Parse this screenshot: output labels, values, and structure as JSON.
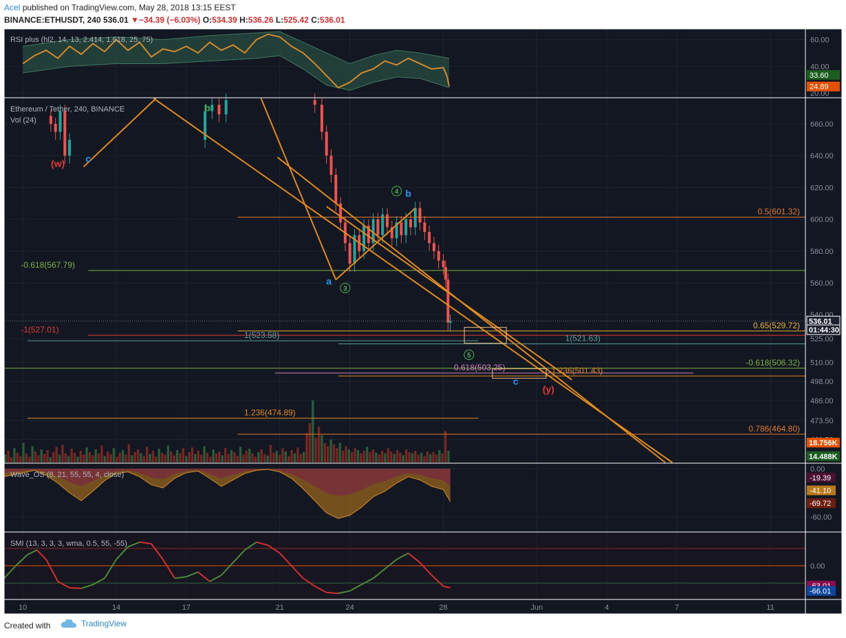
{
  "header": {
    "author": "Acel",
    "published_text": "published on TradingView.com, May 28, 2018 13:15 EEST",
    "symbol": "BINANCE:ETHUSDT, 240",
    "price": "536.01",
    "change": "−34.39 (−6.03%)",
    "o_label": "O:",
    "o_val": "534.39",
    "h_label": "H:",
    "h_val": "536.26",
    "l_label": "L:",
    "l_val": "525.42",
    "c_label": "C:",
    "c_val": "536.01"
  },
  "footer": {
    "created_with": "Created with",
    "brand": "TradingView"
  },
  "colors": {
    "bg": "#131722",
    "border": "#ffffff",
    "grid": "#1e2330",
    "up": "#26a69a",
    "down": "#ef5350",
    "orange": "#e08a1e",
    "fib_orange": "#e07a2e",
    "fib_green": "#7cb342",
    "fib_teal": "#5b9ea0",
    "fib_pink": "#d080c0",
    "wave_red": "#e53935",
    "wave_blue": "#2196f3",
    "wave_green": "#4caf50"
  },
  "chart_data": [
    {
      "type": "line",
      "title": "RSI plus (hl2, 14, 13, 2.414, 1.618, 25, 75)",
      "y_ticks": [
        "60.00",
        "40.00",
        "20.00"
      ],
      "y_range": [
        17,
        68
      ],
      "badges": [
        {
          "text": "33.60",
          "value": 33.6,
          "color": "#1b5e20"
        },
        {
          "text": "24.89",
          "value": 24.89,
          "color": "#e65100"
        }
      ],
      "rsi": [
        [
          10.0,
          42
        ],
        [
          10.5,
          48
        ],
        [
          11.0,
          52
        ],
        [
          11.5,
          46
        ],
        [
          12.0,
          55
        ],
        [
          12.5,
          49
        ],
        [
          13.0,
          57
        ],
        [
          13.5,
          51
        ],
        [
          14.0,
          60
        ],
        [
          14.5,
          52
        ],
        [
          15.0,
          58
        ],
        [
          15.5,
          47
        ],
        [
          16.0,
          53
        ],
        [
          16.5,
          51
        ],
        [
          17.0,
          55
        ],
        [
          17.5,
          50
        ],
        [
          18.0,
          58
        ],
        [
          18.5,
          52
        ],
        [
          19.0,
          56
        ],
        [
          19.5,
          50
        ],
        [
          20.0,
          60
        ],
        [
          20.5,
          64
        ],
        [
          21.0,
          62
        ],
        [
          21.5,
          55
        ],
        [
          22.0,
          50
        ],
        [
          22.5,
          42
        ],
        [
          23.0,
          33
        ],
        [
          23.5,
          24
        ],
        [
          24.0,
          28
        ],
        [
          24.5,
          35
        ],
        [
          25.0,
          38
        ],
        [
          25.5,
          44
        ],
        [
          26.0,
          41
        ],
        [
          26.5,
          46
        ],
        [
          27.0,
          42
        ],
        [
          27.5,
          38
        ],
        [
          28.0,
          39
        ],
        [
          28.15,
          33
        ],
        [
          28.25,
          25
        ]
      ],
      "band_upper": [
        [
          10.0,
          55
        ],
        [
          12.0,
          60
        ],
        [
          14.0,
          62
        ],
        [
          16.0,
          60
        ],
        [
          18.0,
          63
        ],
        [
          20.0,
          65
        ],
        [
          21.0,
          66
        ],
        [
          22.0,
          58
        ],
        [
          23.0,
          50
        ],
        [
          24.0,
          42
        ],
        [
          25.0,
          48
        ],
        [
          26.0,
          52
        ],
        [
          27.0,
          50
        ],
        [
          28.25,
          46
        ]
      ],
      "band_lower": [
        [
          10.0,
          35
        ],
        [
          12.0,
          40
        ],
        [
          14.0,
          42
        ],
        [
          16.0,
          42
        ],
        [
          18.0,
          44
        ],
        [
          20.0,
          46
        ],
        [
          21.0,
          48
        ],
        [
          22.0,
          38
        ],
        [
          23.0,
          26
        ],
        [
          24.0,
          22
        ],
        [
          25.0,
          28
        ],
        [
          26.0,
          32
        ],
        [
          27.0,
          31
        ],
        [
          28.25,
          24
        ]
      ],
      "series_label": ""
    },
    {
      "type": "candlestick",
      "title": "Ethereum / Tether, 240, BINANCE",
      "subtitle": "Vol (24)",
      "y_ticks": [
        "660.00",
        "640.00",
        "620.00",
        "600.00",
        "580.00",
        "560.00",
        "540.00",
        "525.00",
        "510.00",
        "498.00",
        "486.00",
        "473.50",
        "461.50"
      ],
      "y_range": [
        447,
        676
      ],
      "x_ticks": [
        "10",
        "14",
        "17",
        "21",
        "24",
        "28",
        "Jun",
        "4",
        "7",
        "11"
      ],
      "x_tick_days": [
        10,
        14,
        17,
        21,
        24,
        28,
        32,
        35,
        38,
        42
      ],
      "x_range": [
        9.2,
        43.5
      ],
      "badges": [
        {
          "text": "536.01",
          "value": 536.01,
          "color": "#1e2230",
          "border": "#ffffff"
        },
        {
          "text": "01:44:30",
          "value": 530.5,
          "color": "#1e2230",
          "border": "#ffffff"
        },
        {
          "text": "18.756K",
          "value": 459.5,
          "color": "#e65100"
        },
        {
          "text": "14.488K",
          "value": 451,
          "color": "#1b5e20"
        }
      ],
      "closes": [
        [
          11.2,
          660
        ],
        [
          11.4,
          655
        ],
        [
          11.6,
          668
        ],
        [
          11.8,
          640
        ],
        [
          12.0,
          650
        ],
        [
          17.8,
          668
        ],
        [
          18.1,
          672
        ],
        [
          18.4,
          666
        ],
        [
          18.7,
          675
        ],
        [
          22.5,
          672
        ],
        [
          22.8,
          655
        ],
        [
          23.0,
          640
        ],
        [
          23.2,
          628
        ],
        [
          23.4,
          610
        ],
        [
          23.6,
          598
        ],
        [
          23.8,
          585
        ],
        [
          24.0,
          572
        ],
        [
          24.2,
          590
        ],
        [
          24.4,
          580
        ],
        [
          24.6,
          596
        ],
        [
          24.8,
          585
        ],
        [
          25.0,
          600
        ],
        [
          25.2,
          590
        ],
        [
          25.4,
          603
        ],
        [
          25.6,
          595
        ],
        [
          25.8,
          588
        ],
        [
          26.0,
          598
        ],
        [
          26.2,
          590
        ],
        [
          26.4,
          600
        ],
        [
          26.6,
          595
        ],
        [
          26.8,
          607
        ],
        [
          27.0,
          598
        ],
        [
          27.2,
          592
        ],
        [
          27.4,
          585
        ],
        [
          27.6,
          580
        ],
        [
          27.8,
          574
        ],
        [
          28.0,
          570
        ],
        [
          28.1,
          562
        ],
        [
          28.2,
          535
        ],
        [
          28.3,
          536
        ]
      ],
      "volume_k": [
        12,
        18,
        8,
        22,
        15,
        10,
        30,
        14,
        9,
        25,
        17,
        11,
        20,
        13,
        19,
        8,
        16,
        24,
        12,
        27,
        14,
        10,
        21,
        15,
        9,
        18,
        12,
        23,
        16,
        11,
        20,
        14,
        26,
        10,
        17,
        13,
        22,
        9,
        15,
        19,
        12,
        28,
        11,
        16,
        20,
        14,
        10,
        24,
        13,
        18,
        9,
        21,
        15,
        12,
        26,
        17,
        11,
        19,
        14,
        22,
        10,
        16,
        23,
        13,
        18,
        12,
        25,
        15,
        9,
        20,
        14,
        17,
        11,
        22,
        13,
        19,
        16,
        10,
        24,
        12,
        18,
        21,
        14,
        9,
        16,
        20,
        13,
        11,
        27,
        15,
        18,
        12,
        22,
        17,
        10,
        19,
        14,
        23,
        13,
        16,
        45,
        60,
        95,
        38,
        55,
        42,
        30,
        25,
        35,
        28,
        22,
        30,
        18,
        25,
        20,
        16,
        22,
        19,
        14,
        18,
        24,
        16,
        20,
        15,
        12,
        18,
        14,
        22,
        17,
        13,
        19,
        15,
        11,
        20,
        16,
        14,
        18,
        12,
        15,
        10,
        17,
        13,
        16,
        12,
        19,
        14,
        48,
        18
      ],
      "fib_levels": [
        {
          "text": "0.5(601.32)",
          "value": 601.32,
          "color": "#e07a2e",
          "x0": 19.2,
          "x1": 43.5,
          "label_side": "right"
        },
        {
          "text": "-0.618(567.79)",
          "value": 567.79,
          "color": "#7cb342",
          "x0": 12.8,
          "x1": 43.5,
          "label_side": "left"
        },
        {
          "text": "-1(527.01)",
          "value": 527.01,
          "color": "#e53935",
          "x0": 12.8,
          "x1": 43.5,
          "label_side": "left"
        },
        {
          "text": "0.65(529.72)",
          "value": 529.72,
          "color": "#e8b33a",
          "x0": 19.2,
          "x1": 43.5,
          "label_side": "right"
        },
        {
          "text": "1(523.58)",
          "value": 523.58,
          "color": "#5b9ea0",
          "x0": 10.2,
          "x1": 29.5,
          "label_side": "mid"
        },
        {
          "text": "1(521.63)",
          "value": 521.63,
          "color": "#5b9ea0",
          "x0": 23.5,
          "x1": 43.5,
          "label_side": "right-mid"
        },
        {
          "text": "-0.618(506.32)",
          "value": 506.32,
          "color": "#7cb342",
          "x0": 9.2,
          "x1": 43.5,
          "label_side": "right"
        },
        {
          "text": "0.618(503.25)",
          "value": 503.25,
          "color": "#d080c0",
          "x0": 20.8,
          "x1": 38.7,
          "label_side": "mid"
        },
        {
          "text": "1.236(501.43)",
          "value": 501.43,
          "color": "#e08a1e",
          "x0": 23.5,
          "x1": 43.5,
          "label_side": "mid2"
        },
        {
          "text": "1.236(474.89)",
          "value": 474.89,
          "color": "#e08a1e",
          "x0": 10.2,
          "x1": 29.5,
          "label_side": "mid"
        },
        {
          "text": "0.786(464.80)",
          "value": 464.8,
          "color": "#e07a2e",
          "x0": 19.2,
          "x1": 43.5,
          "label_side": "right"
        }
      ],
      "wave_labels": [
        {
          "text": "(w)",
          "day": 11.5,
          "value": 633,
          "color": "#e53935"
        },
        {
          "text": "c",
          "day": 12.8,
          "value": 636,
          "color": "#2196f3"
        },
        {
          "text": "b",
          "day": 17.9,
          "value": 668,
          "color": "#4caf50"
        },
        {
          "text": "a",
          "day": 23.1,
          "value": 559,
          "color": "#2196f3"
        },
        {
          "text": "3",
          "day": 23.8,
          "value": 555,
          "color": "#4caf50",
          "circle": true
        },
        {
          "text": "4",
          "day": 26.0,
          "value": 616,
          "color": "#4caf50",
          "circle": true
        },
        {
          "text": "b",
          "day": 26.5,
          "value": 614,
          "color": "#2196f3"
        },
        {
          "text": "5",
          "day": 29.1,
          "value": 513,
          "color": "#4caf50",
          "circle": true
        },
        {
          "text": "c",
          "day": 31.1,
          "value": 496,
          "color": "#2196f3"
        },
        {
          "text": "(y)",
          "day": 32.5,
          "value": 491,
          "color": "#e53935"
        }
      ]
    },
    {
      "type": "area",
      "title": "Wave_OS (8, 21, 55, 55, 4, close)",
      "y_ticks": [
        "0.00",
        "-60.00"
      ],
      "y_range": [
        -78,
        6
      ],
      "badges": [
        {
          "text": "-19.39",
          "value": -11,
          "color": "#4a1030"
        },
        {
          "text": "-41.10",
          "value": -27,
          "color": "#b9781b"
        },
        {
          "text": "-69.72",
          "value": -43,
          "color": "#6d1e0e"
        }
      ],
      "osc": [
        [
          9.2,
          -10
        ],
        [
          10.0,
          -5
        ],
        [
          10.5,
          -2
        ],
        [
          11.0,
          -8
        ],
        [
          11.5,
          -18
        ],
        [
          12.0,
          -30
        ],
        [
          12.5,
          -40
        ],
        [
          13.0,
          -28
        ],
        [
          13.5,
          -15
        ],
        [
          14.0,
          -6
        ],
        [
          14.5,
          -4
        ],
        [
          15.0,
          -10
        ],
        [
          15.5,
          -20
        ],
        [
          16.0,
          -24
        ],
        [
          16.5,
          -12
        ],
        [
          17.0,
          -5
        ],
        [
          17.5,
          -3
        ],
        [
          18.0,
          -12
        ],
        [
          18.5,
          -22
        ],
        [
          19.0,
          -14
        ],
        [
          19.5,
          -6
        ],
        [
          20.0,
          -2
        ],
        [
          20.5,
          -1
        ],
        [
          21.0,
          -4
        ],
        [
          21.5,
          -12
        ],
        [
          22.0,
          -25
        ],
        [
          22.5,
          -40
        ],
        [
          23.0,
          -55
        ],
        [
          23.5,
          -62
        ],
        [
          24.0,
          -58
        ],
        [
          24.5,
          -48
        ],
        [
          25.0,
          -35
        ],
        [
          25.5,
          -28
        ],
        [
          26.0,
          -18
        ],
        [
          26.5,
          -10
        ],
        [
          27.0,
          -14
        ],
        [
          27.5,
          -22
        ],
        [
          28.0,
          -26
        ],
        [
          28.3,
          -41
        ]
      ]
    },
    {
      "type": "line",
      "title": "SMI (13, 3, 3, 3, wma, 0.5, 55, -55)",
      "y_ticks": [
        "0.00"
      ],
      "y_range": [
        -105,
        105
      ],
      "badges": [
        {
          "text": "-63.01",
          "value": -63,
          "color": "#880e4f"
        },
        {
          "text": "-66.01",
          "value": -80,
          "color": "#0d47a1"
        }
      ],
      "smi": [
        [
          9.2,
          -40
        ],
        [
          9.7,
          0
        ],
        [
          10.2,
          35
        ],
        [
          10.6,
          50
        ],
        [
          11.0,
          20
        ],
        [
          11.5,
          -50
        ],
        [
          12.0,
          -70
        ],
        [
          12.5,
          -72
        ],
        [
          13.0,
          -60
        ],
        [
          13.5,
          -40
        ],
        [
          14.0,
          20
        ],
        [
          14.5,
          60
        ],
        [
          15.0,
          75
        ],
        [
          15.5,
          70
        ],
        [
          16.0,
          20
        ],
        [
          16.5,
          -40
        ],
        [
          17.0,
          -35
        ],
        [
          17.5,
          -20
        ],
        [
          18.0,
          -50
        ],
        [
          18.5,
          -30
        ],
        [
          19.0,
          10
        ],
        [
          19.5,
          50
        ],
        [
          20.0,
          75
        ],
        [
          20.5,
          65
        ],
        [
          21.0,
          40
        ],
        [
          21.5,
          0
        ],
        [
          22.0,
          -40
        ],
        [
          22.5,
          -65
        ],
        [
          23.0,
          -85
        ],
        [
          23.5,
          -88
        ],
        [
          24.0,
          -80
        ],
        [
          24.5,
          -60
        ],
        [
          25.0,
          -40
        ],
        [
          25.5,
          -10
        ],
        [
          26.0,
          20
        ],
        [
          26.5,
          40
        ],
        [
          27.0,
          10
        ],
        [
          27.5,
          -30
        ],
        [
          28.0,
          -65
        ],
        [
          28.3,
          -70
        ]
      ]
    }
  ]
}
